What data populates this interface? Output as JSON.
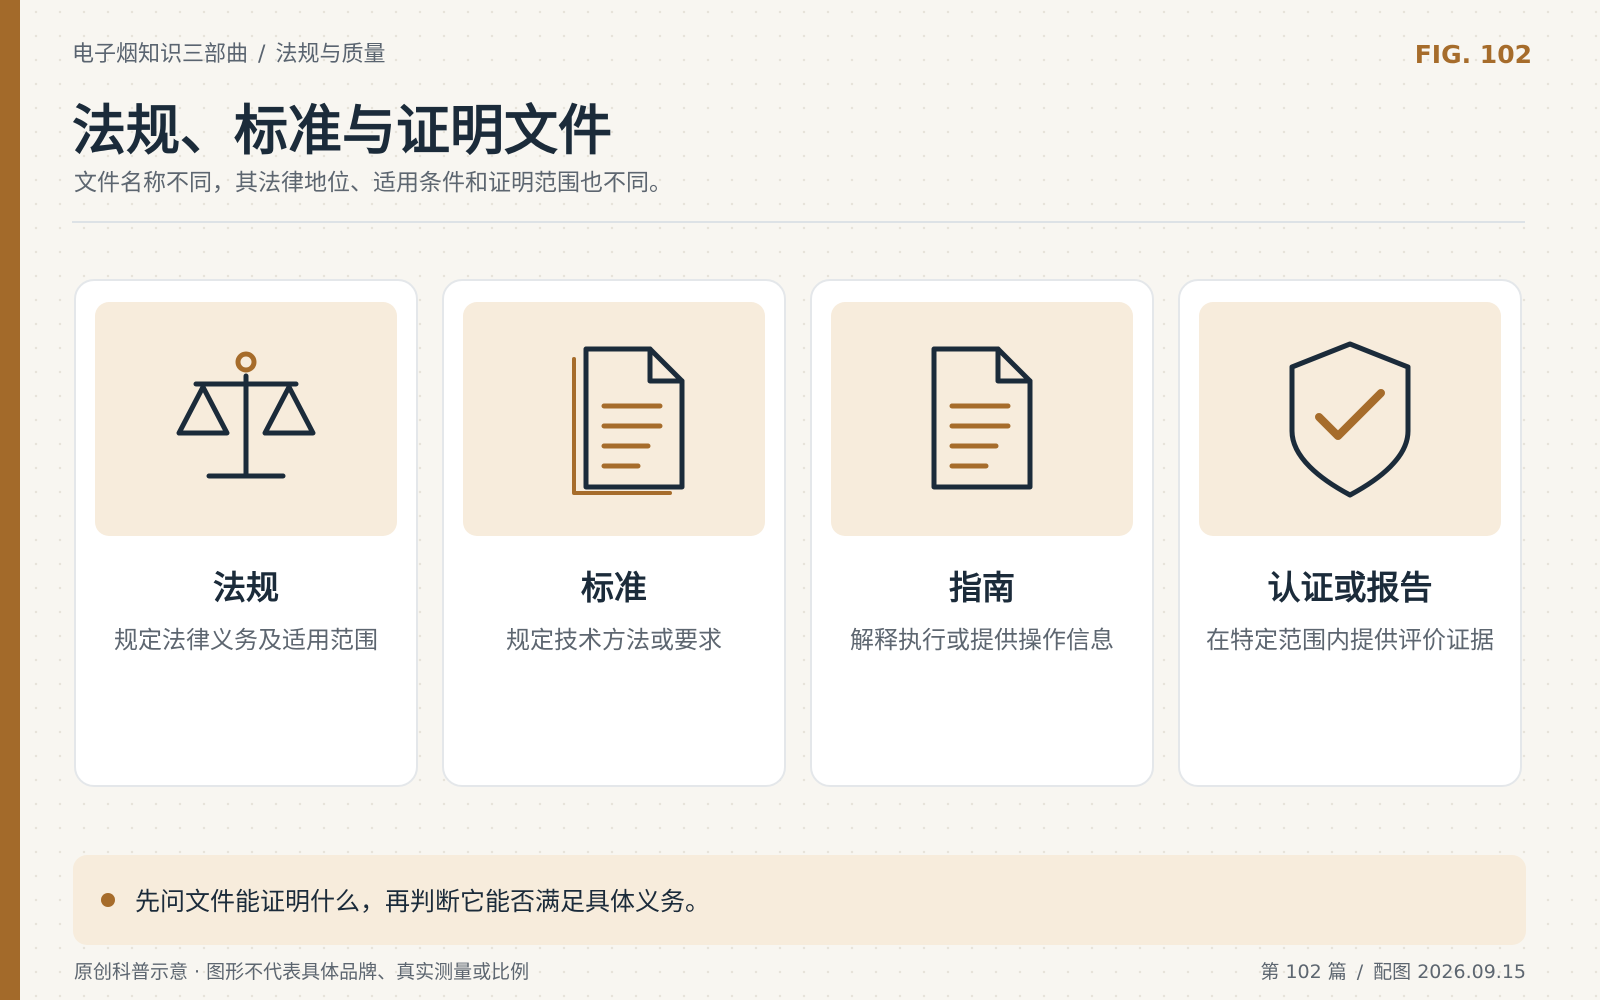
{
  "header": {
    "breadcrumb": [
      "电子烟知识三部曲",
      "法规与质量"
    ],
    "breadcrumb_separator": "/",
    "fig_label": "FIG. 102",
    "title": "法规、标准与证明文件",
    "subtitle": "文件名称不同，其法律地位、适用条件和证明范围也不同。"
  },
  "cards": [
    {
      "icon": "scales-icon",
      "title": "法规",
      "desc": "规定法律义务及适用范围"
    },
    {
      "icon": "document-stack-icon",
      "title": "标准",
      "desc": "规定技术方法或要求"
    },
    {
      "icon": "document-icon",
      "title": "指南",
      "desc": "解释执行或提供操作信息"
    },
    {
      "icon": "shield-check-icon",
      "title": "认证或报告",
      "desc": "在特定范围内提供评价证据"
    }
  ],
  "note": {
    "text": "先问文件能证明什么，再判断它能否满足具体义务。"
  },
  "footer": {
    "left": "原创科普示意 · 图形不代表具体品牌、真实测量或比例",
    "page": "第 102 篇",
    "separator": "/",
    "date": "配图 2026.09.15"
  },
  "colors": {
    "accent": "#a66c2b",
    "navy": "#1b2b3a",
    "panel": "#f7ecdc",
    "background": "#f8f6f1"
  }
}
